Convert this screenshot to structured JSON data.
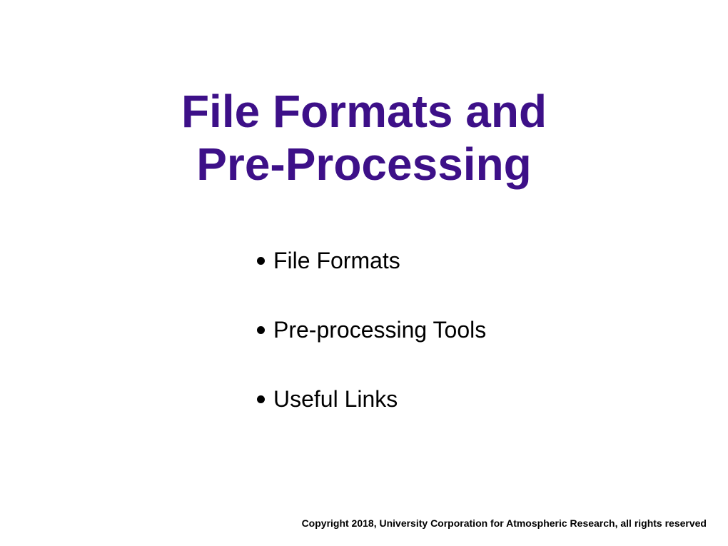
{
  "title_line1": "File Formats and",
  "title_line2": "Pre-Processing",
  "bullets": {
    "item0": "File Formats",
    "item1": "Pre-processing Tools",
    "item2": "Useful Links"
  },
  "footer": "Copyright 2018, University Corporation for Atmospheric Research, all rights reserved"
}
